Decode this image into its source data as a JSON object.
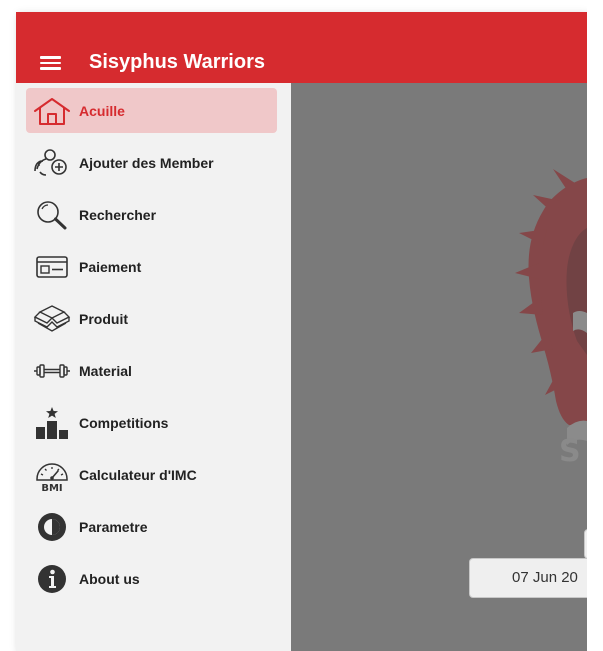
{
  "app": {
    "title": "Sisyphus Warriors"
  },
  "colors": {
    "header": "#d62b2f",
    "active_bg": "#f0c8c9",
    "sidebar_bg": "#f2f2f2",
    "main_bg": "#7a7a7a"
  },
  "sidebar": {
    "items": [
      {
        "label": "Acuille",
        "icon": "home-icon",
        "active": true
      },
      {
        "label": "Ajouter des Member",
        "icon": "add-member-icon",
        "active": false
      },
      {
        "label": "Rechercher",
        "icon": "search-icon",
        "active": false
      },
      {
        "label": "Paiement",
        "icon": "card-icon",
        "active": false
      },
      {
        "label": "Produit",
        "icon": "boxes-icon",
        "active": false
      },
      {
        "label": "Material",
        "icon": "dumbbell-icon",
        "active": false
      },
      {
        "label": "Competitions",
        "icon": "podium-icon",
        "active": false
      },
      {
        "label": "Calculateur d'IMC",
        "icon": "bmi-gauge-icon",
        "active": false
      },
      {
        "label": "Parametre",
        "icon": "settings-icon",
        "active": false
      },
      {
        "label": "About us",
        "icon": "info-icon",
        "active": false
      }
    ]
  },
  "main": {
    "date_value": "07 Jun 20",
    "logo_text": "S"
  }
}
